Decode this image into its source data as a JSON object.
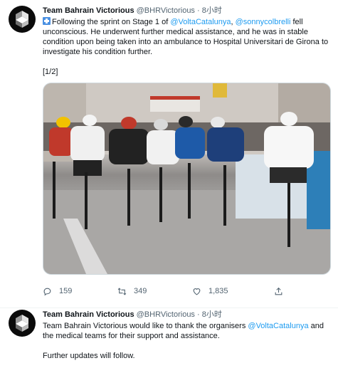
{
  "tweets": [
    {
      "name": "Team Bahrain Victorious",
      "handle": "@BHRVictorious",
      "dot": "·",
      "time": "8小时",
      "text1": "Following the sprint on Stage 1 of ",
      "mention1": "@VoltaCatalunya",
      "comma": ", ",
      "mention2": "@sonnycolbrelli",
      "text2": " fell unconscious. He underwent further medical assistance, and he was in stable condition upon being taken into an ambulance to Hospital Universitari de Girona to investigate his condition further.",
      "counter": "[1/2]",
      "replies": "159",
      "retweets": "349",
      "likes": "1,835"
    },
    {
      "name": "Team Bahrain Victorious",
      "handle": "@BHRVictorious",
      "dot": "·",
      "time": "8小时",
      "text1": "Team Bahrain Victorious would like to thank the organisers ",
      "mention1": "@VoltaCatalunya",
      "text2": " and the medical teams for their support and assistance.",
      "text3": "Further updates will follow."
    }
  ],
  "colors": {
    "link": "#1d9bf0",
    "muted": "#536471"
  },
  "icons": [
    "bahrain-victorious-logo",
    "hospital-emoji",
    "reply-icon",
    "retweet-icon",
    "like-icon",
    "share-icon"
  ]
}
